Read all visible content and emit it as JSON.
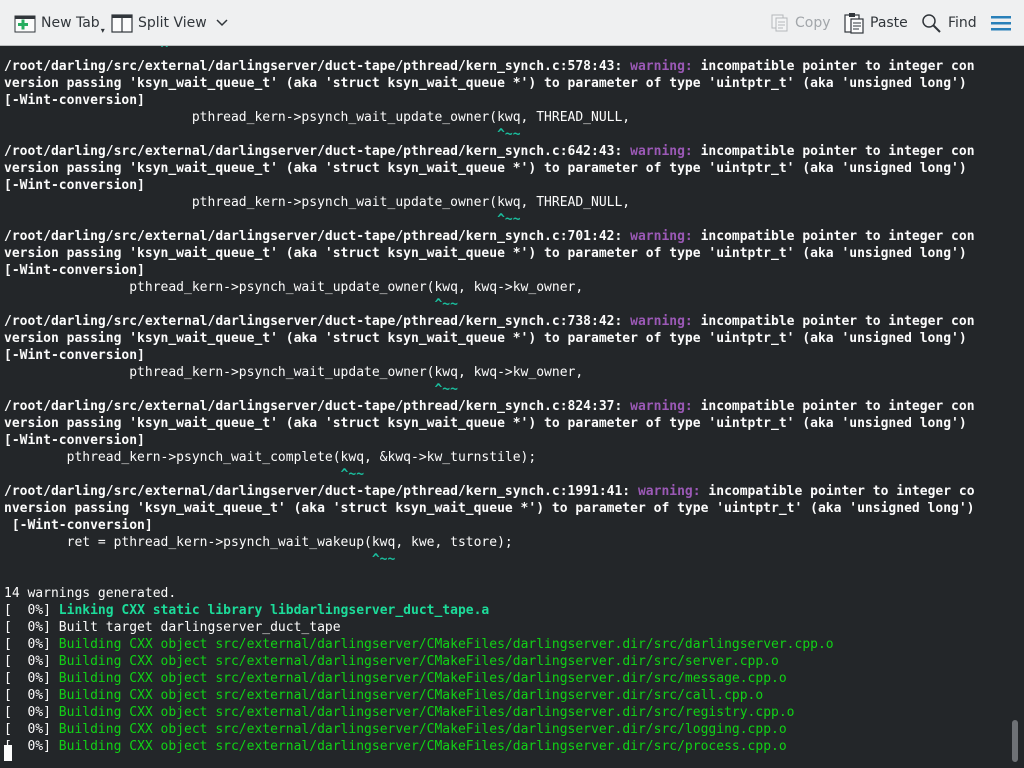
{
  "toolbar": {
    "new_tab": "New Tab",
    "split_view": "Split View",
    "copy": "Copy",
    "paste": "Paste",
    "find": "Find"
  },
  "terminal": {
    "lines": [
      {
        "segs": [
          {
            "t": "                    ^",
            "c": "caret"
          }
        ]
      },
      {
        "segs": [
          {
            "t": "/root/darling/src/external/darlingserver/duct-tape/pthread/kern_synch.c:578:43: ",
            "c": "b"
          },
          {
            "t": "warning:",
            "c": "warn"
          },
          {
            "t": " incompatible pointer to integer con",
            "c": "b"
          }
        ]
      },
      {
        "segs": [
          {
            "t": "version passing 'ksyn_wait_queue_t' (aka 'struct ksyn_wait_queue *') to parameter of type 'uintptr_t' (aka 'unsigned long')",
            "c": "b"
          }
        ]
      },
      {
        "segs": [
          {
            "t": "[-Wint-conversion]",
            "c": "b"
          }
        ]
      },
      {
        "segs": [
          {
            "t": "                        pthread_kern->psynch_wait_update_owner(kwq, THREAD_NULL,",
            "c": ""
          }
        ]
      },
      {
        "segs": [
          {
            "t": "                                                               ^~~",
            "c": "caret"
          }
        ]
      },
      {
        "segs": [
          {
            "t": "/root/darling/src/external/darlingserver/duct-tape/pthread/kern_synch.c:642:43: ",
            "c": "b"
          },
          {
            "t": "warning:",
            "c": "warn"
          },
          {
            "t": " incompatible pointer to integer con",
            "c": "b"
          }
        ]
      },
      {
        "segs": [
          {
            "t": "version passing 'ksyn_wait_queue_t' (aka 'struct ksyn_wait_queue *') to parameter of type 'uintptr_t' (aka 'unsigned long')",
            "c": "b"
          }
        ]
      },
      {
        "segs": [
          {
            "t": "[-Wint-conversion]",
            "c": "b"
          }
        ]
      },
      {
        "segs": [
          {
            "t": "                        pthread_kern->psynch_wait_update_owner(kwq, THREAD_NULL,",
            "c": ""
          }
        ]
      },
      {
        "segs": [
          {
            "t": "                                                               ^~~",
            "c": "caret"
          }
        ]
      },
      {
        "segs": [
          {
            "t": "/root/darling/src/external/darlingserver/duct-tape/pthread/kern_synch.c:701:42: ",
            "c": "b"
          },
          {
            "t": "warning:",
            "c": "warn"
          },
          {
            "t": " incompatible pointer to integer con",
            "c": "b"
          }
        ]
      },
      {
        "segs": [
          {
            "t": "version passing 'ksyn_wait_queue_t' (aka 'struct ksyn_wait_queue *') to parameter of type 'uintptr_t' (aka 'unsigned long')",
            "c": "b"
          }
        ]
      },
      {
        "segs": [
          {
            "t": "[-Wint-conversion]",
            "c": "b"
          }
        ]
      },
      {
        "segs": [
          {
            "t": "                pthread_kern->psynch_wait_update_owner(kwq, kwq->kw_owner,",
            "c": ""
          }
        ]
      },
      {
        "segs": [
          {
            "t": "                                                       ^~~",
            "c": "caret"
          }
        ]
      },
      {
        "segs": [
          {
            "t": "/root/darling/src/external/darlingserver/duct-tape/pthread/kern_synch.c:738:42: ",
            "c": "b"
          },
          {
            "t": "warning:",
            "c": "warn"
          },
          {
            "t": " incompatible pointer to integer con",
            "c": "b"
          }
        ]
      },
      {
        "segs": [
          {
            "t": "version passing 'ksyn_wait_queue_t' (aka 'struct ksyn_wait_queue *') to parameter of type 'uintptr_t' (aka 'unsigned long')",
            "c": "b"
          }
        ]
      },
      {
        "segs": [
          {
            "t": "[-Wint-conversion]",
            "c": "b"
          }
        ]
      },
      {
        "segs": [
          {
            "t": "                pthread_kern->psynch_wait_update_owner(kwq, kwq->kw_owner,",
            "c": ""
          }
        ]
      },
      {
        "segs": [
          {
            "t": "                                                       ^~~",
            "c": "caret"
          }
        ]
      },
      {
        "segs": [
          {
            "t": "/root/darling/src/external/darlingserver/duct-tape/pthread/kern_synch.c:824:37: ",
            "c": "b"
          },
          {
            "t": "warning:",
            "c": "warn"
          },
          {
            "t": " incompatible pointer to integer con",
            "c": "b"
          }
        ]
      },
      {
        "segs": [
          {
            "t": "version passing 'ksyn_wait_queue_t' (aka 'struct ksyn_wait_queue *') to parameter of type 'uintptr_t' (aka 'unsigned long')",
            "c": "b"
          }
        ]
      },
      {
        "segs": [
          {
            "t": "[-Wint-conversion]",
            "c": "b"
          }
        ]
      },
      {
        "segs": [
          {
            "t": "        pthread_kern->psynch_wait_complete(kwq, &kwq->kw_turnstile);",
            "c": ""
          }
        ]
      },
      {
        "segs": [
          {
            "t": "                                           ^~~",
            "c": "caret"
          }
        ]
      },
      {
        "segs": [
          {
            "t": "/root/darling/src/external/darlingserver/duct-tape/pthread/kern_synch.c:1991:41: ",
            "c": "b"
          },
          {
            "t": "warning:",
            "c": "warn"
          },
          {
            "t": " incompatible pointer to integer co",
            "c": "b"
          }
        ]
      },
      {
        "segs": [
          {
            "t": "nversion passing 'ksyn_wait_queue_t' (aka 'struct ksyn_wait_queue *') to parameter of type 'uintptr_t' (aka 'unsigned long')",
            "c": "b"
          }
        ]
      },
      {
        "segs": [
          {
            "t": " [-Wint-conversion]",
            "c": "b"
          }
        ]
      },
      {
        "segs": [
          {
            "t": "        ret = pthread_kern->psynch_wait_wakeup(kwq, kwe, tstore);",
            "c": ""
          }
        ]
      },
      {
        "segs": [
          {
            "t": "                                               ^~~",
            "c": "caret"
          }
        ]
      },
      {
        "segs": [
          {
            "t": "",
            "c": ""
          }
        ]
      },
      {
        "segs": [
          {
            "t": "14 warnings generated.",
            "c": ""
          }
        ]
      },
      {
        "segs": [
          {
            "t": "[  0%] ",
            "c": ""
          },
          {
            "t": "Linking CXX static library libdarlingserver_duct_tape.a",
            "c": "greenb"
          }
        ]
      },
      {
        "segs": [
          {
            "t": "[  0%] Built target darlingserver_duct_tape",
            "c": ""
          }
        ]
      },
      {
        "segs": [
          {
            "t": "[  0%] ",
            "c": ""
          },
          {
            "t": "Building CXX object src/external/darlingserver/CMakeFiles/darlingserver.dir/src/darlingserver.cpp.o",
            "c": "green"
          }
        ]
      },
      {
        "segs": [
          {
            "t": "[  0%] ",
            "c": ""
          },
          {
            "t": "Building CXX object src/external/darlingserver/CMakeFiles/darlingserver.dir/src/server.cpp.o",
            "c": "green"
          }
        ]
      },
      {
        "segs": [
          {
            "t": "[  0%] ",
            "c": ""
          },
          {
            "t": "Building CXX object src/external/darlingserver/CMakeFiles/darlingserver.dir/src/message.cpp.o",
            "c": "green"
          }
        ]
      },
      {
        "segs": [
          {
            "t": "[  0%] ",
            "c": ""
          },
          {
            "t": "Building CXX object src/external/darlingserver/CMakeFiles/darlingserver.dir/src/call.cpp.o",
            "c": "green"
          }
        ]
      },
      {
        "segs": [
          {
            "t": "[  0%] ",
            "c": ""
          },
          {
            "t": "Building CXX object src/external/darlingserver/CMakeFiles/darlingserver.dir/src/registry.cpp.o",
            "c": "green"
          }
        ]
      },
      {
        "segs": [
          {
            "t": "[  0%] ",
            "c": ""
          },
          {
            "t": "Building CXX object src/external/darlingserver/CMakeFiles/darlingserver.dir/src/logging.cpp.o",
            "c": "green"
          }
        ]
      },
      {
        "segs": [
          {
            "t": "[  0%] ",
            "c": ""
          },
          {
            "t": "Building CXX object src/external/darlingserver/CMakeFiles/darlingserver.dir/src/process.cpp.o",
            "c": "green"
          }
        ]
      }
    ]
  },
  "colors": {
    "background": "#232629",
    "warning": "#9b59b6",
    "caret": "#1abc9c",
    "build_green": "#11d116",
    "link_green": "#1cdc9a",
    "toolbar_bg": "#eff0f1",
    "accent": "#3daee9"
  }
}
